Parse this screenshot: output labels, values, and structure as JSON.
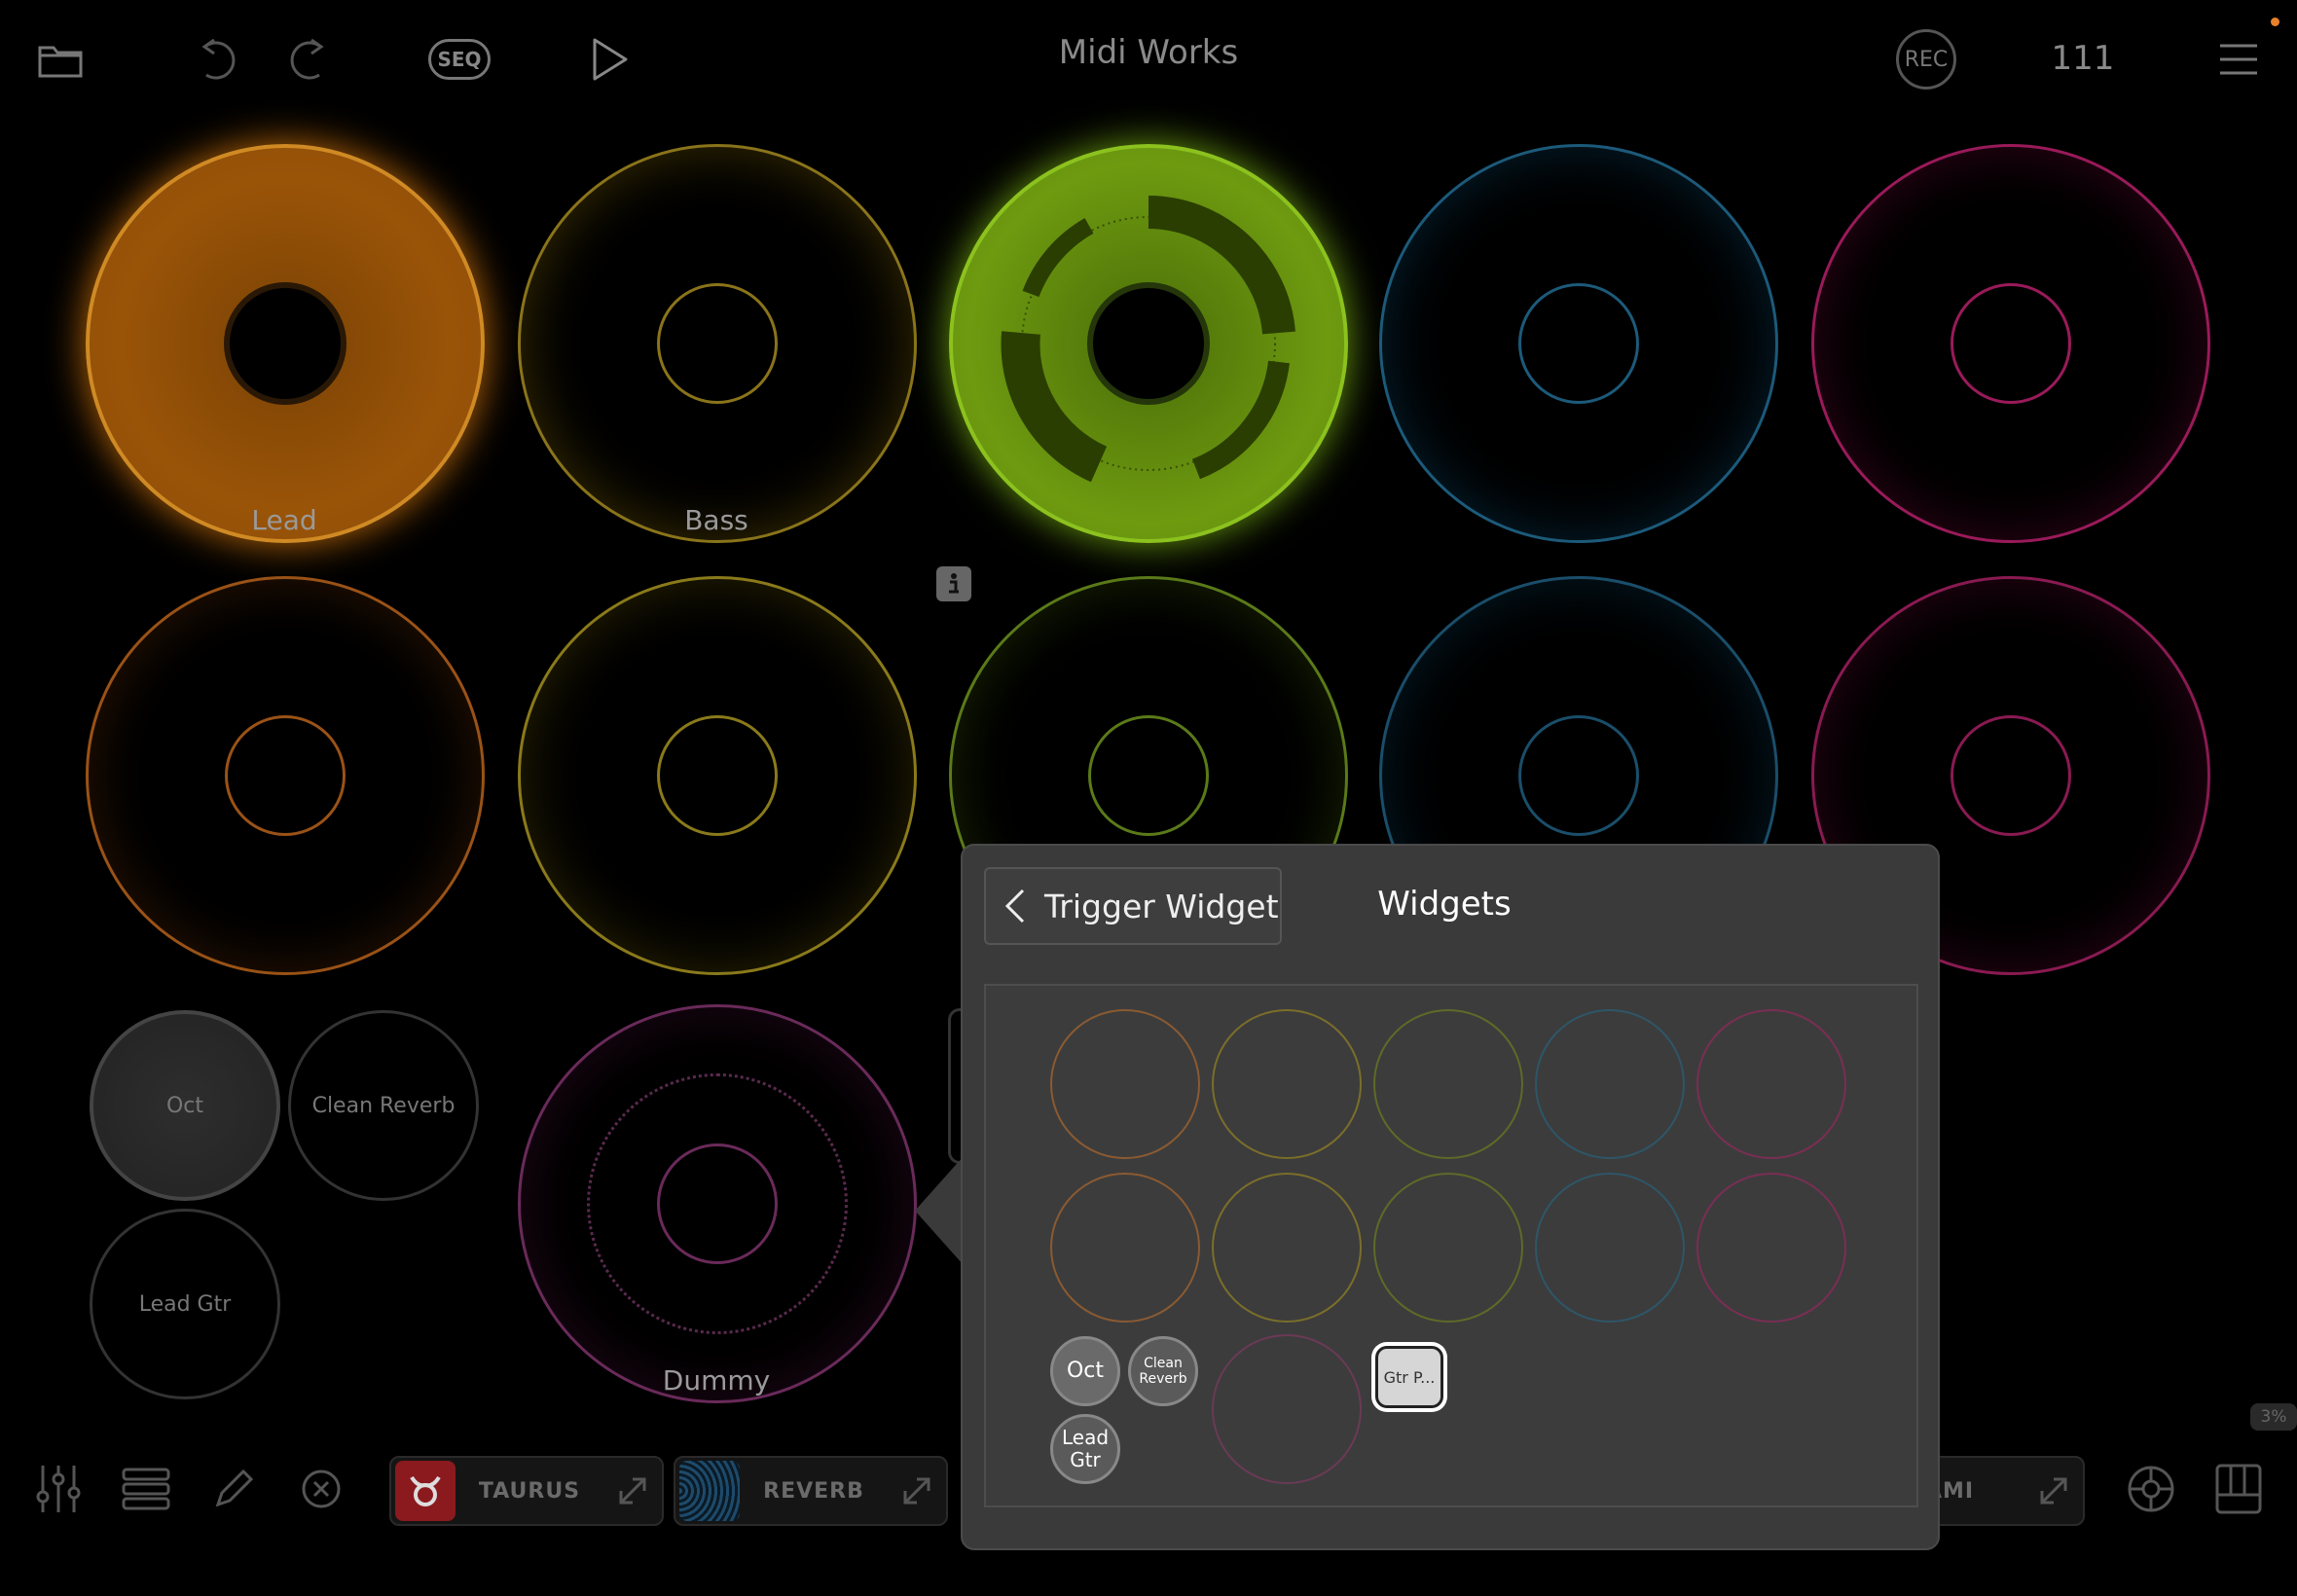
{
  "header": {
    "title": "Midi Works",
    "seq_label": "SEQ",
    "rec_label": "REC",
    "tempo": "111"
  },
  "pads": {
    "row1": [
      {
        "label": "Lead",
        "color": "#d8821c",
        "active": true
      },
      {
        "label": "Bass",
        "color": "#a58a1e",
        "active": false
      },
      {
        "label": "",
        "color": "#8cc21e",
        "active": true
      },
      {
        "label": "",
        "color": "#1c6a8c",
        "active": false
      },
      {
        "label": "",
        "color": "#b41a6c",
        "active": false
      }
    ],
    "row2_colors": [
      "#b8621a",
      "#a2901c",
      "#6a8a1a",
      "#1c5a7a",
      "#a81c64"
    ],
    "dummy": {
      "label": "Dummy",
      "color": "#9a3a7a"
    }
  },
  "widgets": [
    {
      "label": "Oct"
    },
    {
      "label": "Clean Reverb"
    },
    {
      "label": "Lead Gtr"
    }
  ],
  "bottom_bar": {
    "fx": [
      {
        "label": "TAURUS",
        "color": "#c8242a"
      },
      {
        "label": "REVERB",
        "color": "#1e4a6a"
      },
      {
        "label": "AMI"
      }
    ],
    "percent_badge": "3%"
  },
  "popover": {
    "back_label": "Trigger Widget",
    "title": "Widgets",
    "mini_widgets": {
      "oct": "Oct",
      "clean_reverb_1": "Clean",
      "clean_reverb_2": "Reverb",
      "lead_gtr_1": "Lead",
      "lead_gtr_2": "Gtr",
      "selected": "Gtr P..."
    }
  }
}
